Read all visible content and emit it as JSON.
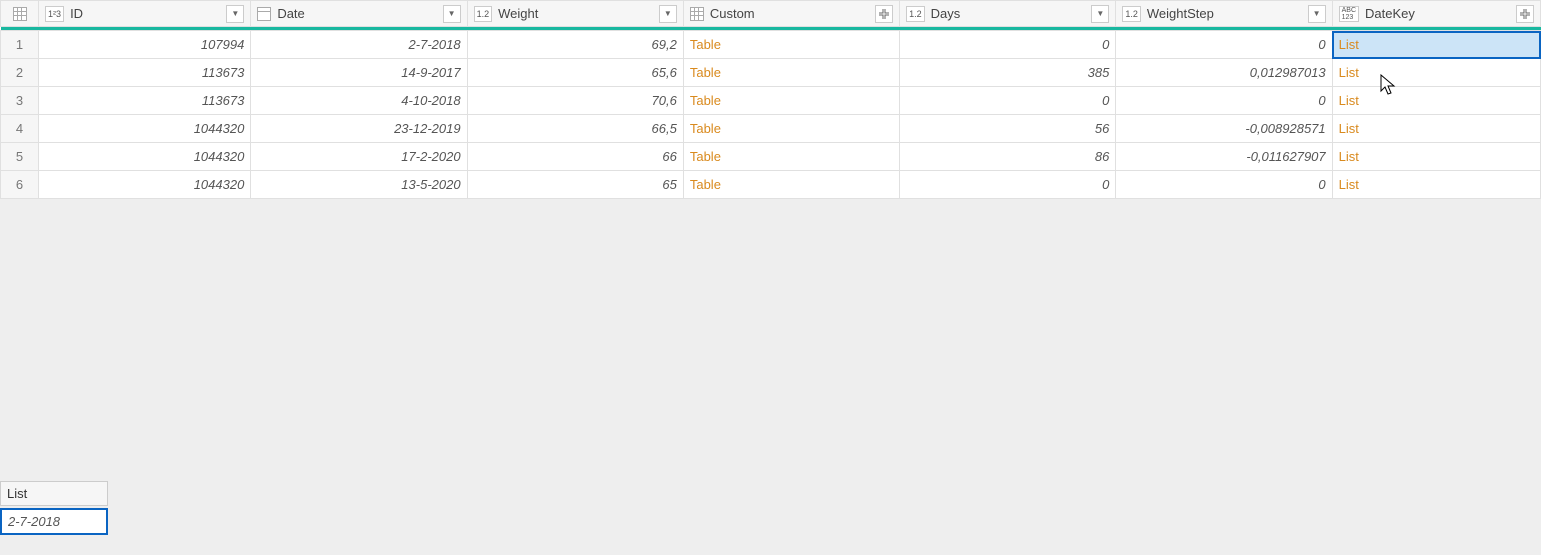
{
  "columns": {
    "id": {
      "label": "ID",
      "type_badge": "1²3"
    },
    "date": {
      "label": "Date",
      "type_badge": "date"
    },
    "weight": {
      "label": "Weight",
      "type_badge": "1.2"
    },
    "custom": {
      "label": "Custom",
      "type_badge": "table"
    },
    "days": {
      "label": "Days",
      "type_badge": "1.2"
    },
    "step": {
      "label": "WeightStep",
      "type_badge": "1.2"
    },
    "datekey": {
      "label": "DateKey",
      "type_badge": "ABC123"
    }
  },
  "rows": [
    {
      "n": "1",
      "id": "107994",
      "date": "2-7-2018",
      "weight": "69,2",
      "custom": "Table",
      "days": "0",
      "step": "0",
      "datekey": "List"
    },
    {
      "n": "2",
      "id": "113673",
      "date": "14-9-2017",
      "weight": "65,6",
      "custom": "Table",
      "days": "385",
      "step": "0,012987013",
      "datekey": "List"
    },
    {
      "n": "3",
      "id": "113673",
      "date": "4-10-2018",
      "weight": "70,6",
      "custom": "Table",
      "days": "0",
      "step": "0",
      "datekey": "List"
    },
    {
      "n": "4",
      "id": "1044320",
      "date": "23-12-2019",
      "weight": "66,5",
      "custom": "Table",
      "days": "56",
      "step": "-0,008928571",
      "datekey": "List"
    },
    {
      "n": "5",
      "id": "1044320",
      "date": "17-2-2020",
      "weight": "66",
      "custom": "Table",
      "days": "86",
      "step": "-0,011627907",
      "datekey": "List"
    },
    {
      "n": "6",
      "id": "1044320",
      "date": "13-5-2020",
      "weight": "65",
      "custom": "Table",
      "days": "0",
      "step": "0",
      "datekey": "List"
    }
  ],
  "detail": {
    "header": "List",
    "value": "2-7-2018"
  },
  "type_labels": {
    "int": "1²3",
    "dec": "1.2",
    "abc": "ABC\n123"
  }
}
